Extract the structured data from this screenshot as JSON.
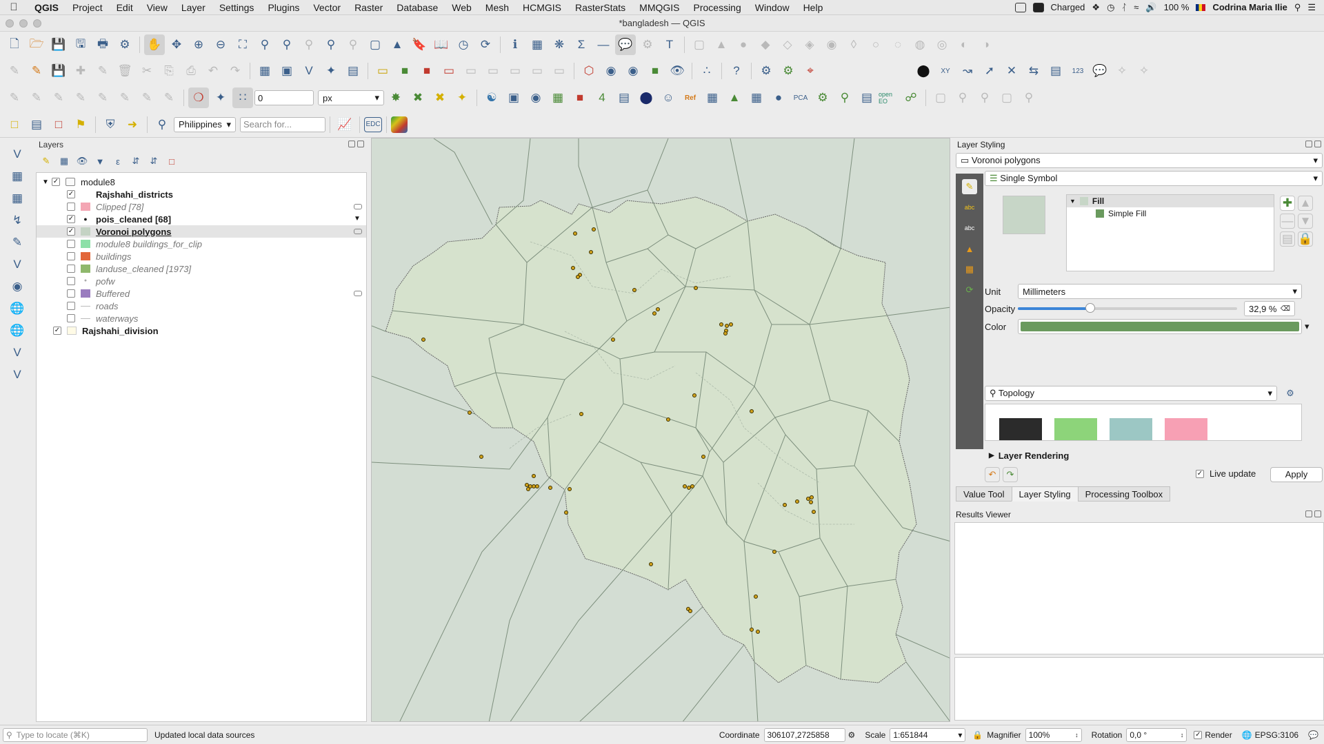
{
  "menubar": {
    "app": "QGIS",
    "items": [
      "Project",
      "Edit",
      "View",
      "Layer",
      "Settings",
      "Plugins",
      "Vector",
      "Raster",
      "Database",
      "Web",
      "Mesh",
      "HCMGIS",
      "RasterStats",
      "MMQGIS",
      "Processing",
      "Window",
      "Help"
    ],
    "battery_status": "Charged",
    "battery_percent": "100 %",
    "user": "Codrina Maria Ilie"
  },
  "window": {
    "title": "*bangladesh — QGIS"
  },
  "toolbar": {
    "snapping_tolerance": "0",
    "snapping_unit": "px",
    "locator_country": "Philippines",
    "search_placeholder": "Search for...",
    "edc_label": "EDC",
    "ref_label": "Ref",
    "pca_label": "PCA",
    "openeo_label": "open EO",
    "num_label": "123",
    "xy_label": "XY"
  },
  "layers_panel": {
    "title": "Layers",
    "items": [
      {
        "name": "module8",
        "checked": true,
        "style": "group",
        "color": ""
      },
      {
        "name": "Rajshahi_districts",
        "checked": true,
        "style": "bold",
        "color": "#ffffff"
      },
      {
        "name": "Clipped [78]",
        "checked": false,
        "style": "italic",
        "color": "#f4a6b4"
      },
      {
        "name": "pois_cleaned [68]",
        "checked": true,
        "style": "bold",
        "color": "point"
      },
      {
        "name": "Voronoi polygons",
        "checked": true,
        "style": "bold-underline",
        "color": "#c4d3c4"
      },
      {
        "name": "module8 buildings_for_clip",
        "checked": false,
        "style": "italic",
        "color": "#8de0a8"
      },
      {
        "name": "buildings",
        "checked": false,
        "style": "italic",
        "color": "#e2673a"
      },
      {
        "name": "landuse_cleaned [1973]",
        "checked": false,
        "style": "italic",
        "color": "#8fb86c"
      },
      {
        "name": "pofw",
        "checked": false,
        "style": "italic",
        "color": "point"
      },
      {
        "name": "Buffered",
        "checked": false,
        "style": "italic",
        "color": "#9a7cbf"
      },
      {
        "name": "roads",
        "checked": false,
        "style": "italic",
        "color": "line"
      },
      {
        "name": "waterways",
        "checked": false,
        "style": "italic",
        "color": "line"
      },
      {
        "name": "Rajshahi_division",
        "checked": true,
        "style": "bold",
        "color": "#fffbe6"
      }
    ]
  },
  "layer_styling": {
    "title": "Layer Styling",
    "layer": "Voronoi polygons",
    "renderer": "Single Symbol",
    "tree_fill": "Fill",
    "tree_simple_fill": "Simple Fill",
    "unit_label": "Unit",
    "unit_value": "Millimeters",
    "opacity_label": "Opacity",
    "opacity_value": "32,9 %",
    "opacity_fraction": 0.329,
    "color_label": "Color",
    "color_value": "#6a9a5e",
    "symbol_search": "Topology",
    "layer_rendering": "Layer Rendering",
    "live_update": "Live update",
    "apply": "Apply",
    "preview_color": "#c7d6c7",
    "swatches": [
      "#2b2b2b",
      "#8dd47a",
      "#9cc7c4",
      "#f7a0b4"
    ]
  },
  "bottom_tabs": [
    "Value Tool",
    "Layer Styling",
    "Processing Toolbox"
  ],
  "results_viewer": {
    "title": "Results Viewer"
  },
  "statusbar": {
    "locate_placeholder": "Type to locate (⌘K)",
    "message": "Updated local data sources",
    "coordinate_label": "Coordinate",
    "coordinate": "306107,2725858",
    "scale_label": "Scale",
    "scale": "1:651844",
    "magnifier_label": "Magnifier",
    "magnifier": "100%",
    "rotation_label": "Rotation",
    "rotation": "0,0 °",
    "render_label": "Render",
    "crs": "EPSG:3106"
  },
  "colors": {
    "map_bg": "#d3ddd3",
    "region_fill": "#d6e2cd",
    "voronoi_line": "#7d8f7d",
    "poi_fill": "#d1a21c"
  }
}
